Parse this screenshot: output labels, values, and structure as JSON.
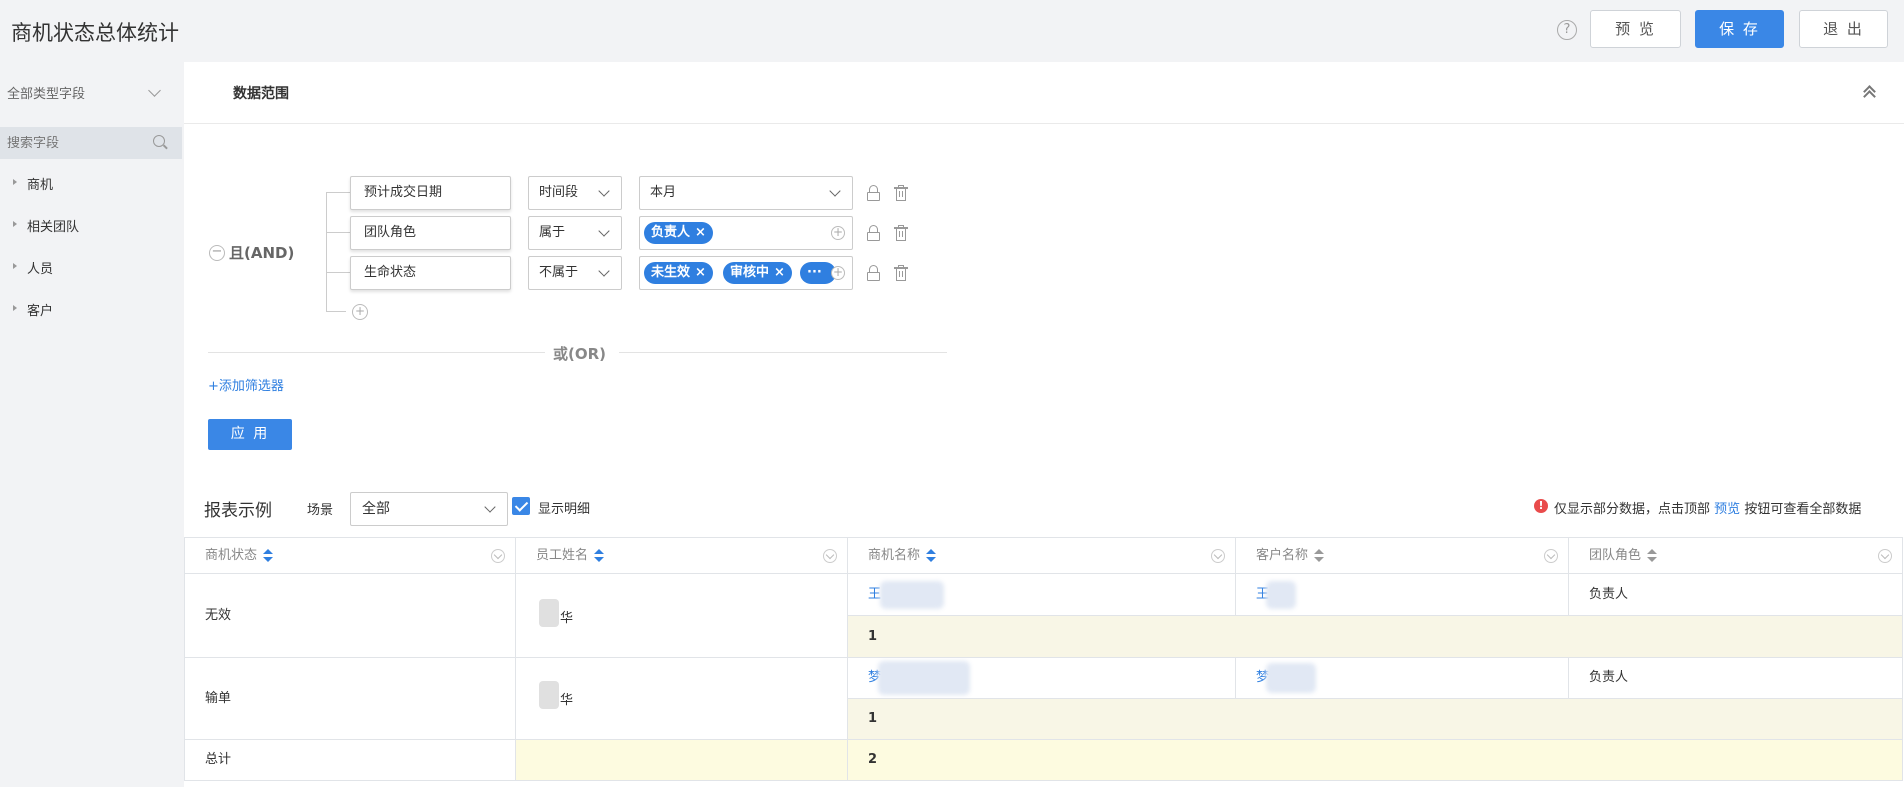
{
  "header": {
    "title": "商机状态总体统计",
    "help": "?",
    "preview_label": "预 览",
    "save_label": "保 存",
    "exit_label": "退 出"
  },
  "sidebar": {
    "type_select": "全部类型字段",
    "search_placeholder": "搜索字段",
    "items": [
      {
        "label": "商机"
      },
      {
        "label": "相关团队"
      },
      {
        "label": "人员"
      },
      {
        "label": "客户"
      }
    ]
  },
  "filter": {
    "title": "数据范围",
    "and_label": "且(AND)",
    "conditions": [
      {
        "field": "预计成交日期",
        "operator": "时间段",
        "value": "本月",
        "tags": []
      },
      {
        "field": "团队角色",
        "operator": "属于",
        "value": "",
        "tags": [
          "负责人"
        ]
      },
      {
        "field": "生命状态",
        "operator": "不属于",
        "value": "",
        "tags": [
          "未生效",
          "审核中",
          "···"
        ]
      }
    ],
    "or_label": "或(OR)",
    "add_filter": "+添加筛选器",
    "apply_label": "应 用"
  },
  "report": {
    "title": "报表示例",
    "scene_label": "场景",
    "scene_value": "全部",
    "show_detail_label": "显示明细",
    "show_detail_checked": true,
    "notice_icon": "!",
    "notice_before": "仅显示部分数据，点击顶部",
    "notice_link": "预览",
    "notice_after": "按钮可查看全部数据",
    "columns": [
      "商机状态",
      "员工姓名",
      "商机名称",
      "客户名称",
      "团队角色"
    ],
    "rows": [
      {
        "status": "无效",
        "employee": "华",
        "opportunity": "王 2",
        "customer": "王 子",
        "role": "负责人",
        "subtotal": "1"
      },
      {
        "status": "输单",
        "employee": "华",
        "opportunity": "梦 ",
        "customer": "梦 林",
        "role": "负责人",
        "subtotal": "1"
      }
    ],
    "total_label": "总计",
    "total_value": "2"
  },
  "colors": {
    "primary": "#3a87e6",
    "link": "#2f7fe0",
    "subtotal_bg": "#f8f6e6",
    "total_bg": "#fdfbe0"
  }
}
